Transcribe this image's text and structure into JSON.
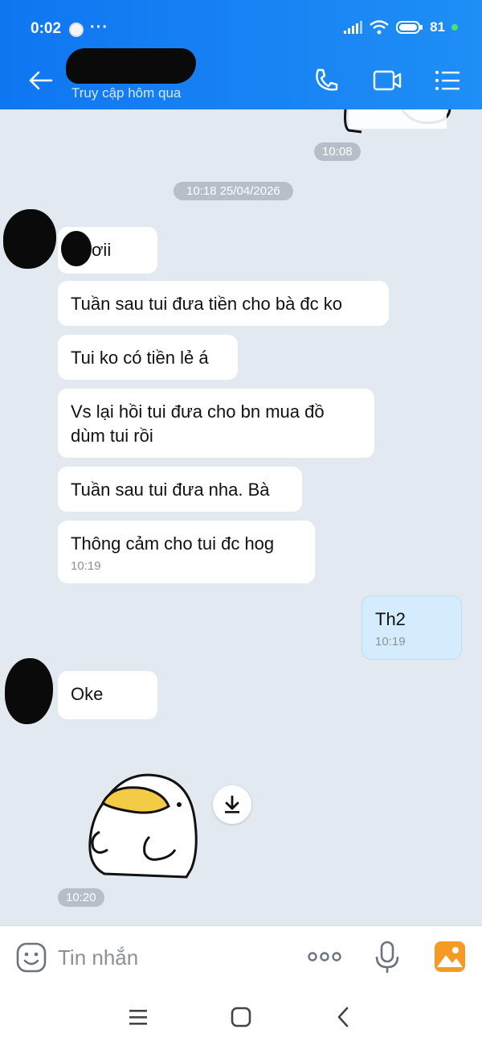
{
  "status_bar": {
    "time": "0:02",
    "more": "···",
    "battery": "81"
  },
  "header": {
    "subtitle": "Truy cập hôm qua",
    "icons": [
      "back-arrow-icon",
      "phone-icon",
      "video-call-icon",
      "menu-list-icon"
    ]
  },
  "chat": {
    "top_time": "10:08",
    "date_divider": "10:18 25/04/2026",
    "received_1": [
      {
        "text": "ơii"
      },
      {
        "text": "Tuần sau tui đưa tiền cho bà đc ko"
      },
      {
        "text": "Tui ko có tiền lẻ á"
      },
      {
        "text": "Vs lại hồi tui đưa cho bn mua đồ dùm tui rồi"
      },
      {
        "text": "Tuần sau tui đưa nha. Bà"
      },
      {
        "text": "Thông cảm cho tui đc hog",
        "time": "10:19"
      }
    ],
    "sent": {
      "text": "Th2",
      "time": "10:19"
    },
    "received_2": {
      "text": "Oke"
    },
    "sticker_time": "10:20"
  },
  "composer": {
    "placeholder": "Tin nhắn",
    "icons": [
      "emoji-icon",
      "more-dots-icon",
      "microphone-icon",
      "gallery-icon"
    ]
  },
  "system_nav": {
    "icons": [
      "recents-icon",
      "home-icon",
      "back-icon"
    ]
  },
  "colors": {
    "header_blue": "#1583f3",
    "sent_bubble": "#d5ecff",
    "chat_bg": "#e2e9f1"
  }
}
